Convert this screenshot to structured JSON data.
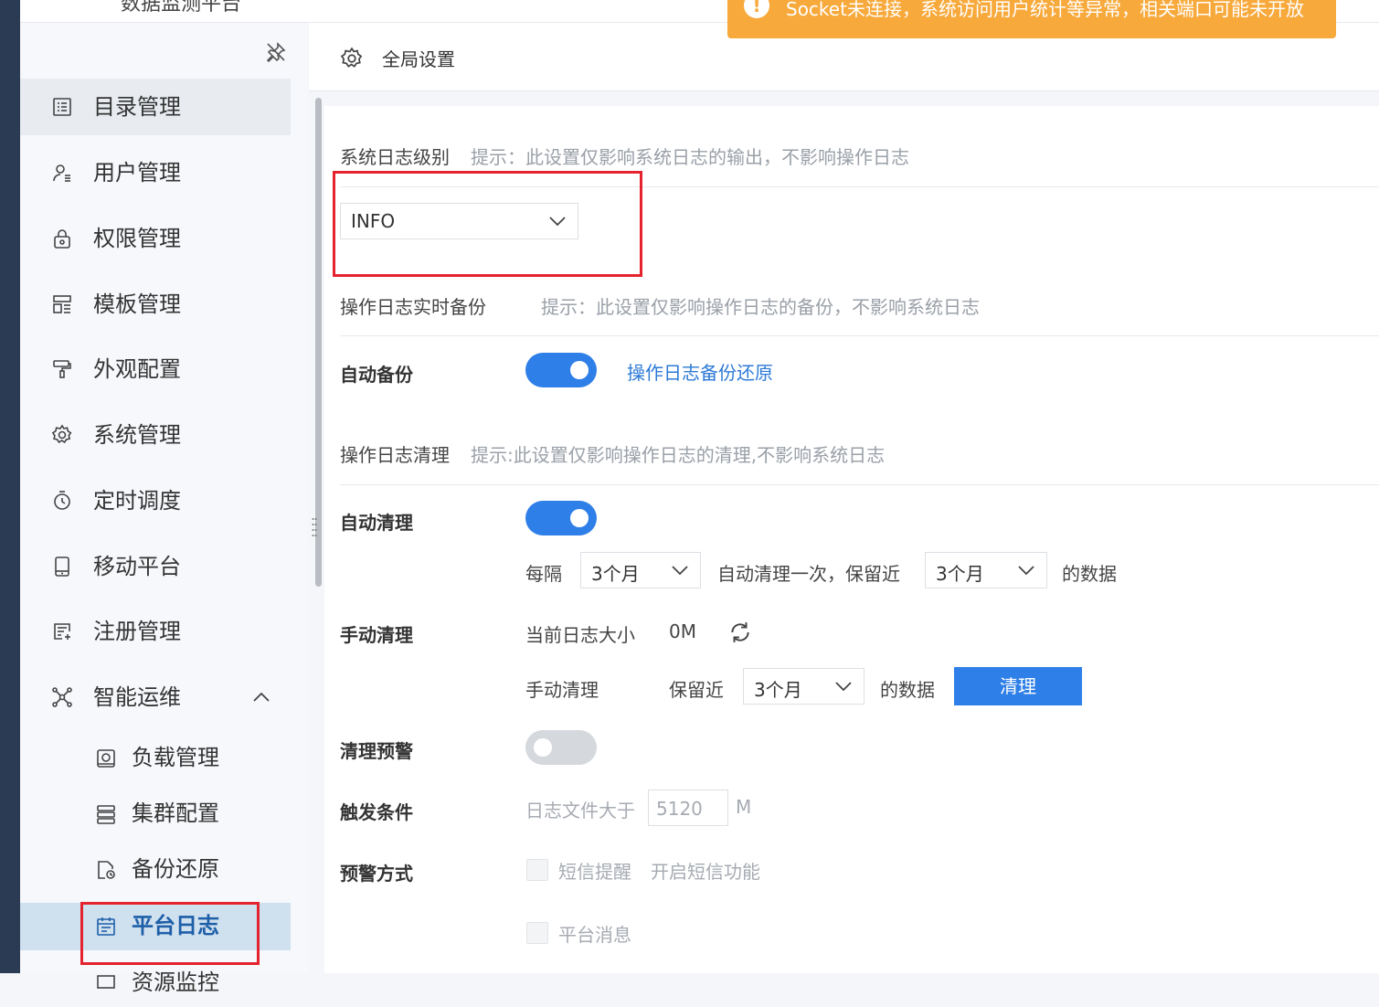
{
  "app": {
    "title_cut": "数据监测平台"
  },
  "toast": {
    "text": "Socket未连接，系统访问用户统计等异常，相关端口可能未开放",
    "color": "#f8a93b"
  },
  "sidebar": {
    "items": [
      {
        "label": "目录管理",
        "icon": "list-icon"
      },
      {
        "label": "用户管理",
        "icon": "user-icon"
      },
      {
        "label": "权限管理",
        "icon": "lock-icon"
      },
      {
        "label": "模板管理",
        "icon": "template-icon"
      },
      {
        "label": "外观配置",
        "icon": "paint-roller-icon"
      },
      {
        "label": "系统管理",
        "icon": "gear-icon"
      },
      {
        "label": "定时调度",
        "icon": "timer-icon"
      },
      {
        "label": "移动平台",
        "icon": "mobile-icon"
      },
      {
        "label": "注册管理",
        "icon": "register-icon"
      },
      {
        "label": "智能运维",
        "icon": "network-icon",
        "expanded": true
      }
    ],
    "sub_items": [
      {
        "label": "负载管理",
        "icon": "load-icon"
      },
      {
        "label": "集群配置",
        "icon": "server-icon"
      },
      {
        "label": "备份还原",
        "icon": "backup-icon"
      },
      {
        "label": "平台日志",
        "icon": "calendar-icon",
        "active": true
      },
      {
        "label": "资源监控",
        "icon": "monitor-icon"
      }
    ]
  },
  "header": {
    "title": "全局设置"
  },
  "syslog": {
    "title": "系统日志级别",
    "hint": "提示：此设置仅影响系统日志的输出，不影响操作日志",
    "level": "INFO"
  },
  "backup": {
    "title": "操作日志实时备份",
    "hint": "提示：此设置仅影响操作日志的备份，不影响系统日志",
    "auto_label": "自动备份",
    "auto_on": true,
    "restore_link": "操作日志备份还原"
  },
  "cleanup": {
    "title": "操作日志清理",
    "hint": "提示:此设置仅影响操作日志的清理,不影响系统日志",
    "auto_label": "自动清理",
    "auto_on": true,
    "every_label": "每隔",
    "interval": "3个月",
    "mid_text": "自动清理一次，保留近",
    "keep": "3个月",
    "suffix": "的数据",
    "manual_label": "手动清理",
    "size_label": "当前日志大小",
    "size_value": "0M",
    "manual_sub_label": "手动清理",
    "keep_label": "保留近",
    "manual_keep": "3个月",
    "manual_suffix": "的数据",
    "clean_button": "清理"
  },
  "warning": {
    "label": "清理预警",
    "on": false,
    "trigger_label": "触发条件",
    "trigger_text": "日志文件大于",
    "trigger_value": "5120",
    "trigger_unit": "M",
    "method_label": "预警方式",
    "sms_label": "短信提醒",
    "sms_link": "开启短信功能",
    "platform_msg": "平台消息"
  }
}
